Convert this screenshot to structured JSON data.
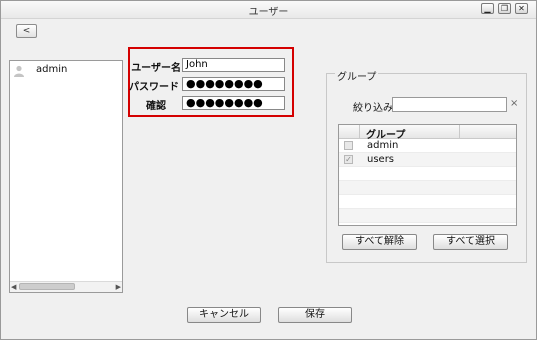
{
  "window": {
    "title": "ユーザー",
    "minimize_glyph": "▁",
    "restore_glyph": "❐",
    "close_glyph": "✕"
  },
  "nav": {
    "back_glyph": "<"
  },
  "users": {
    "items": [
      {
        "label": "admin",
        "icon": "person-icon"
      }
    ]
  },
  "form": {
    "username_label": "ユーザー名",
    "username_value": "John",
    "password_label": "パスワード",
    "password_value": "●●●●●●●●",
    "confirm_label": "確認",
    "confirm_value": "●●●●●●●●",
    "highlight_color": "#d40000"
  },
  "groups": {
    "legend": "グループ",
    "filter_label": "絞り込み",
    "filter_value": "",
    "clear_glyph": "×",
    "column_header": "グループ",
    "rows": [
      {
        "name": "admin",
        "checked": false
      },
      {
        "name": "users",
        "checked": true
      }
    ],
    "deselect_all_label": "すべて解除",
    "select_all_label": "すべて選択"
  },
  "footer": {
    "cancel_label": "キャンセル",
    "save_label": "保存"
  }
}
